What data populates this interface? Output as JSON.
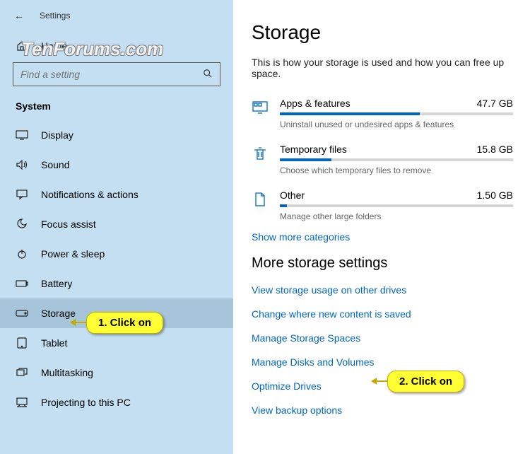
{
  "titlebar": {
    "title": "Settings"
  },
  "sidebar": {
    "home": "Home",
    "search_placeholder": "Find a setting",
    "category": "System",
    "items": [
      {
        "label": "Display"
      },
      {
        "label": "Sound"
      },
      {
        "label": "Notifications & actions"
      },
      {
        "label": "Focus assist"
      },
      {
        "label": "Power & sleep"
      },
      {
        "label": "Battery"
      },
      {
        "label": "Storage"
      },
      {
        "label": "Tablet"
      },
      {
        "label": "Multitasking"
      },
      {
        "label": "Projecting to this PC"
      }
    ]
  },
  "main": {
    "title": "Storage",
    "subtitle": "This is how your storage is used and how you can free up space.",
    "storage": [
      {
        "name": "Apps & features",
        "size": "47.7 GB",
        "desc": "Uninstall unused or undesired apps & features",
        "pct": 60
      },
      {
        "name": "Temporary files",
        "size": "15.8 GB",
        "desc": "Choose which temporary files to remove",
        "pct": 22
      },
      {
        "name": "Other",
        "size": "1.50 GB",
        "desc": "Manage other large folders",
        "pct": 3
      }
    ],
    "show_more": "Show more categories",
    "more_title": "More storage settings",
    "links": [
      "View storage usage on other drives",
      "Change where new content is saved",
      "Manage Storage Spaces",
      "Manage Disks and Volumes",
      "Optimize Drives",
      "View backup options"
    ]
  },
  "watermark": "TenForums.com",
  "callouts": {
    "c1": "1. Click on",
    "c2": "2. Click on"
  }
}
